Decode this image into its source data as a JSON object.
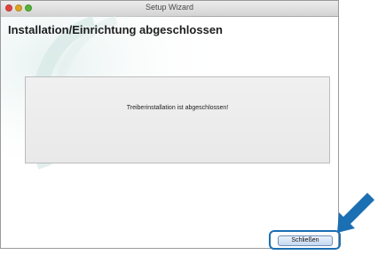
{
  "window": {
    "title": "Setup Wizard",
    "heading": "Installation/Einrichtung abgeschlossen",
    "message": "Treiberinstallation ist abgeschlossen!",
    "close_button_label": "Schließen"
  },
  "colors": {
    "highlight": "#1b6fb3",
    "arrow": "#1b6fb3",
    "close_light": "#e0443e",
    "minimize_light": "#dea123",
    "zoom_light": "#55b33a"
  }
}
